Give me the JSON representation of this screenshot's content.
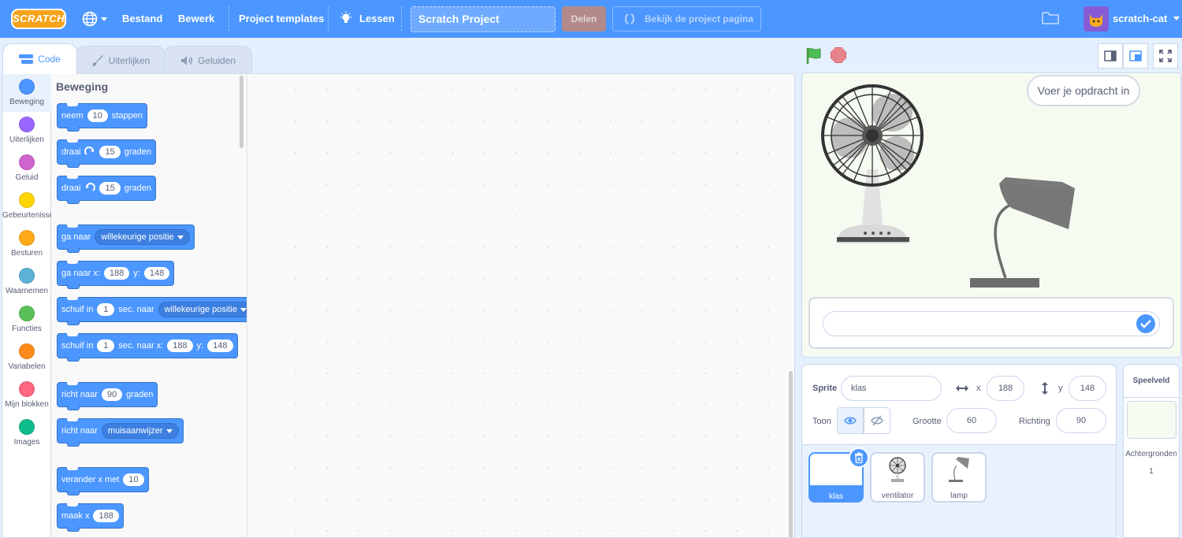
{
  "menubar": {
    "logo": "SCRATCH",
    "file": "Bestand",
    "edit": "Bewerk",
    "templates": "Project templates",
    "tutorials": "Lessen",
    "project_title": "Scratch Project",
    "share": "Delen",
    "see_project": "Bekijk de project pagina",
    "username": "scratch-cat"
  },
  "tabs": [
    {
      "label": "Code",
      "icon": "code-icon"
    },
    {
      "label": "Uiterlijken",
      "icon": "brush-icon"
    },
    {
      "label": "Geluiden",
      "icon": "speaker-icon"
    }
  ],
  "categories": [
    {
      "label": "Beweging",
      "color": "#4c97ff"
    },
    {
      "label": "Uiterlijken",
      "color": "#9966ff"
    },
    {
      "label": "Geluid",
      "color": "#cf63cf"
    },
    {
      "label": "Gebeurtenissen",
      "color": "#ffd500"
    },
    {
      "label": "Besturen",
      "color": "#ffab19"
    },
    {
      "label": "Waarnemen",
      "color": "#5cb1d6"
    },
    {
      "label": "Functies",
      "color": "#59c059"
    },
    {
      "label": "Variabelen",
      "color": "#ff8c1a"
    },
    {
      "label": "Mijn blokken",
      "color": "#ff6680"
    },
    {
      "label": "Images",
      "color": "#0fbd8c"
    }
  ],
  "palette": {
    "title": "Beweging",
    "blocks": {
      "move": {
        "a": "neem",
        "n": "10",
        "b": "stappen"
      },
      "turn_right": {
        "a": "draai",
        "n": "15",
        "b": "graden"
      },
      "turn_left": {
        "a": "draai",
        "n": "15",
        "b": "graden"
      },
      "goto": {
        "a": "ga naar",
        "dd": "willekeurige positie"
      },
      "goto_xy": {
        "a": "ga naar x:",
        "x": "188",
        "b": "y:",
        "y": "148"
      },
      "glide": {
        "a": "schuif in",
        "n": "1",
        "b": "sec. naar",
        "dd": "willekeurige positie"
      },
      "glide_xy": {
        "a": "schuif in",
        "n": "1",
        "b": "sec. naar x:",
        "x": "188",
        "c": "y:",
        "y": "148"
      },
      "point_dir": {
        "a": "richt naar",
        "n": "90",
        "b": "graden"
      },
      "point_towards": {
        "a": "richt naar",
        "dd": "muisaanwijzer"
      },
      "change_x": {
        "a": "verander x met",
        "n": "10"
      },
      "set_x": {
        "a": "maak x",
        "n": "188"
      }
    }
  },
  "stage": {
    "bubble": "Voer je opdracht in",
    "ask_value": "",
    "background": "#f5fbf1"
  },
  "sprite_info": {
    "sprite_label": "Sprite",
    "sprite_name": "klas",
    "x_label": "x",
    "x": "188",
    "y_label": "y",
    "y": "148",
    "show_label": "Toon",
    "size_label": "Grootte",
    "size": "60",
    "direction_label": "Richting",
    "direction": "90"
  },
  "sprites": [
    {
      "name": "klas",
      "selected": true
    },
    {
      "name": "ventilator",
      "selected": false
    },
    {
      "name": "lamp",
      "selected": false
    }
  ],
  "stage_panel": {
    "title": "Speelveld",
    "backdrops_label": "Achtergronden",
    "backdrops_count": "1"
  },
  "colors": {
    "accent": "#4c97ff",
    "motion_block": "#4c97ff"
  }
}
